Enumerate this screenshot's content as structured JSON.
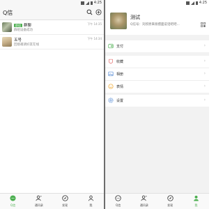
{
  "left": {
    "status": {
      "time": "4:25"
    },
    "app_title": "Q信",
    "chats": [
      {
        "badge": "群组",
        "name": "群聊",
        "preview": "群组设备成功",
        "time": "下午 14:35"
      },
      {
        "badge": "",
        "name": "五号",
        "preview": "回接邀请好友在线",
        "time": "下午 14:34"
      }
    ],
    "nav": [
      {
        "label": "Q信",
        "icon": "chat-bubble-icon",
        "active": true
      },
      {
        "label": "通讯录",
        "icon": "contacts-icon",
        "active": false
      },
      {
        "label": "发现",
        "icon": "compass-icon",
        "active": false
      },
      {
        "label": "我",
        "icon": "person-icon",
        "active": false
      }
    ]
  },
  "right": {
    "status": {
      "time": "4:25"
    },
    "profile": {
      "name": "测试",
      "qq_line": "Q信号：刘欣原来很擅面说话吧吧..."
    },
    "menu_groups": [
      [
        {
          "label": "支付",
          "icon": "wallet-icon"
        }
      ],
      [
        {
          "label": "收藏",
          "icon": "collection-icon"
        },
        {
          "label": "相册",
          "icon": "album-icon"
        },
        {
          "label": "表情",
          "icon": "emoji-icon"
        }
      ],
      [
        {
          "label": "设置",
          "icon": "gear-icon"
        }
      ]
    ],
    "nav": [
      {
        "label": "Q信",
        "icon": "chat-bubble-icon",
        "active": false
      },
      {
        "label": "通讯录",
        "icon": "contacts-icon",
        "active": false
      },
      {
        "label": "发现",
        "icon": "compass-icon",
        "active": false
      },
      {
        "label": "我",
        "icon": "person-icon",
        "active": true
      }
    ]
  },
  "colors": {
    "accent": "#4caf50",
    "divider": "#6d6d6d"
  }
}
